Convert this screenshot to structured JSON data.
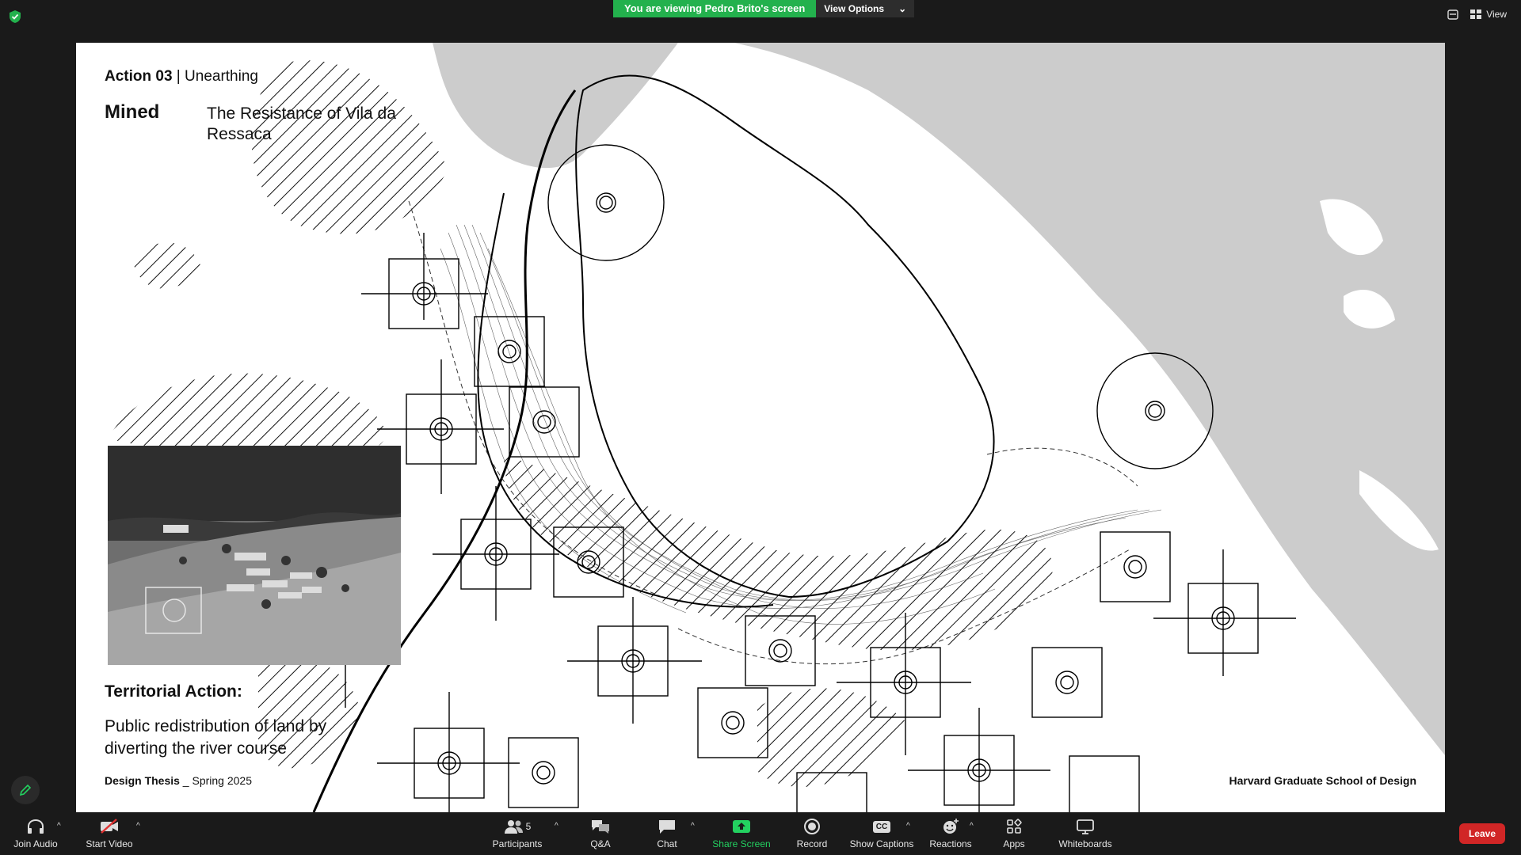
{
  "banner": {
    "viewing_text": "You are viewing Pedro Brito's screen",
    "view_options_label": "View Options"
  },
  "top_right": {
    "view_label": "View"
  },
  "slide": {
    "action_bold": "Action 03",
    "action_rest": " | Unearthing",
    "mined": "Mined",
    "subtitle": "The Resistance of Vila da Ressaca",
    "territorial_title": "Territorial Action:",
    "territorial_body": "Public redistribution of land by diverting the river course",
    "design_bold": "Design Thesis",
    "design_rest": " _ Spring 2025",
    "school": "Harvard Graduate School of Design"
  },
  "toolbar": {
    "join_audio": "Join Audio",
    "start_video": "Start Video",
    "participants": "Participants",
    "participants_count": "5",
    "qa": "Q&A",
    "chat": "Chat",
    "share_screen": "Share Screen",
    "record": "Record",
    "show_captions": "Show Captions",
    "captions_badge": "CC",
    "reactions": "Reactions",
    "apps": "Apps",
    "whiteboards": "Whiteboards",
    "leave": "Leave"
  },
  "colors": {
    "toolbar_bg": "#1a1a1a",
    "share_green": "#23d160",
    "banner_green": "#23b14d",
    "leave_red": "#d12626",
    "map_water": "#cccccc"
  }
}
